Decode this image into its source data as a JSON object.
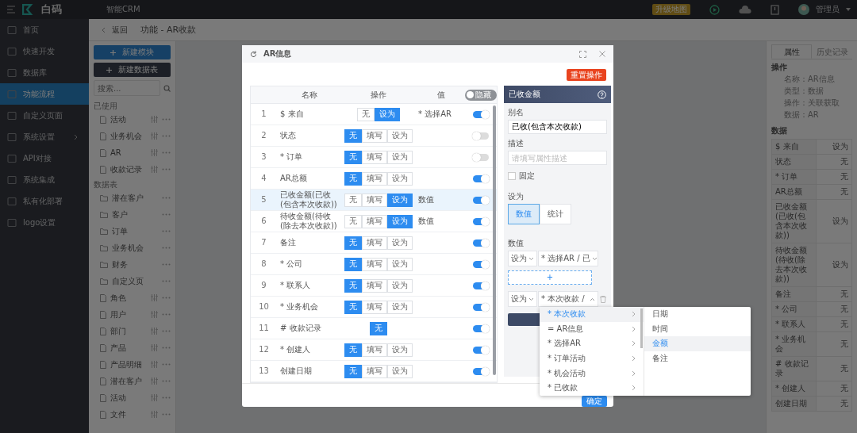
{
  "topbar": {
    "brand": "白码",
    "app": "智能CRM",
    "badge": "升级地图",
    "user": "管理员"
  },
  "nav": [
    {
      "label": "首页",
      "selected": false,
      "expandable": false
    },
    {
      "label": "快速开发",
      "selected": false,
      "expandable": false
    },
    {
      "label": "数据库",
      "selected": false,
      "expandable": false
    },
    {
      "label": "功能流程",
      "selected": true,
      "expandable": false
    },
    {
      "label": "自定义页面",
      "selected": false,
      "expandable": false
    },
    {
      "label": "系统设置",
      "selected": false,
      "expandable": true
    },
    {
      "label": "API对接",
      "selected": false,
      "expandable": false
    },
    {
      "label": "系统集成",
      "selected": false,
      "expandable": false
    },
    {
      "label": "私有化部署",
      "selected": false,
      "expandable": false
    },
    {
      "label": "logo设置",
      "selected": false,
      "expandable": false
    }
  ],
  "breadcrumb": {
    "back": "返回",
    "path": "功能 - AR收款"
  },
  "module_panel": {
    "buttons": [
      "新建模块",
      "新建数据表"
    ],
    "search_placeholder": "搜索...",
    "groups": [
      {
        "title": "已使用",
        "items": [
          {
            "label": "活动",
            "kind": "file"
          },
          {
            "label": "业务机会",
            "kind": "file"
          },
          {
            "label": "AR",
            "kind": "file"
          },
          {
            "label": "收款记录",
            "kind": "file"
          }
        ]
      },
      {
        "title": "数据表",
        "items": [
          {
            "label": "潜在客户",
            "kind": "folder"
          },
          {
            "label": "客户",
            "kind": "folder"
          },
          {
            "label": "订单",
            "kind": "folder"
          },
          {
            "label": "业务机会",
            "kind": "folder"
          },
          {
            "label": "财务",
            "kind": "folder"
          },
          {
            "label": "自定义页",
            "kind": "folder"
          },
          {
            "label": "角色",
            "kind": "file"
          },
          {
            "label": "用户",
            "kind": "file"
          },
          {
            "label": "部门",
            "kind": "file"
          },
          {
            "label": "产品",
            "kind": "file"
          },
          {
            "label": "产品明细",
            "kind": "file"
          },
          {
            "label": "潜在客户",
            "kind": "file"
          },
          {
            "label": "活动",
            "kind": "file"
          },
          {
            "label": "文件",
            "kind": "file"
          }
        ]
      }
    ]
  },
  "properties": {
    "tabs": [
      {
        "label": "属性",
        "selected": true
      },
      {
        "label": "历史记录",
        "selected": false
      }
    ],
    "operation_title": "操作",
    "operation_lines": [
      "名称：AR信息",
      "类型：数据",
      "操作：关联获取",
      "数据：AR"
    ],
    "data_title": "数据",
    "rows": [
      {
        "name": "$ 来自",
        "value": "设为"
      },
      {
        "name": "状态",
        "value": "无"
      },
      {
        "name": "* 订单",
        "value": "无"
      },
      {
        "name": "AR总额",
        "value": "无"
      },
      {
        "name": "已收金额(已收(包含本次收款))",
        "value": "设为"
      },
      {
        "name": "待收金额(待收(除去本次收款))",
        "value": "设为"
      },
      {
        "name": "备注",
        "value": "无"
      },
      {
        "name": "* 公司",
        "value": "无"
      },
      {
        "name": "* 联系人",
        "value": "无"
      },
      {
        "name": "* 业务机会",
        "value": "无"
      },
      {
        "name": "# 收款记录",
        "value": "无"
      },
      {
        "name": "* 创建人",
        "value": "无"
      },
      {
        "name": "创建日期",
        "value": "无"
      }
    ]
  },
  "dialog": {
    "title": "AR信息",
    "reset_button": "重置操作",
    "columns": [
      "名称",
      "操作",
      "值"
    ],
    "hide_toggle": {
      "label": "隐藏",
      "on": false
    },
    "rows": [
      {
        "index": "1",
        "name": "$ 来自",
        "options": [
          {
            "label": "无",
            "selected": false
          },
          {
            "label": "设为",
            "selected": true
          }
        ],
        "value": "* 选择AR",
        "visible": true,
        "selected": false
      },
      {
        "index": "2",
        "name": "状态",
        "options": [
          {
            "label": "无",
            "selected": true
          },
          {
            "label": "填写",
            "selected": false
          },
          {
            "label": "设为",
            "selected": false
          }
        ],
        "visible": false,
        "selected": false
      },
      {
        "index": "3",
        "name": "* 订单",
        "options": [
          {
            "label": "无",
            "selected": true
          },
          {
            "label": "填写",
            "selected": false
          },
          {
            "label": "设为",
            "selected": false
          }
        ],
        "visible": false,
        "selected": false
      },
      {
        "index": "4",
        "name": "AR总额",
        "options": [
          {
            "label": "无",
            "selected": true
          },
          {
            "label": "填写",
            "selected": false
          },
          {
            "label": "设为",
            "selected": false
          }
        ],
        "visible": true,
        "selected": false
      },
      {
        "index": "5",
        "name": "已收金额(已收(包含本次收款))",
        "options": [
          {
            "label": "无",
            "selected": false
          },
          {
            "label": "填写",
            "selected": false
          },
          {
            "label": "设为",
            "selected": true
          }
        ],
        "value": "数值",
        "visible": true,
        "selected": true
      },
      {
        "index": "6",
        "name": "待收金额(待收(除去本次收款))",
        "options": [
          {
            "label": "无",
            "selected": false
          },
          {
            "label": "填写",
            "selected": false
          },
          {
            "label": "设为",
            "selected": true
          }
        ],
        "value": "数值",
        "visible": true,
        "selected": false
      },
      {
        "index": "7",
        "name": "备注",
        "options": [
          {
            "label": "无",
            "selected": true
          },
          {
            "label": "填写",
            "selected": false
          },
          {
            "label": "设为",
            "selected": false
          }
        ],
        "visible": true,
        "selected": false
      },
      {
        "index": "8",
        "name": "* 公司",
        "options": [
          {
            "label": "无",
            "selected": true
          },
          {
            "label": "填写",
            "selected": false
          },
          {
            "label": "设为",
            "selected": false
          }
        ],
        "visible": true,
        "selected": false
      },
      {
        "index": "9",
        "name": "* 联系人",
        "options": [
          {
            "label": "无",
            "selected": true
          },
          {
            "label": "填写",
            "selected": false
          },
          {
            "label": "设为",
            "selected": false
          }
        ],
        "visible": true,
        "selected": false
      },
      {
        "index": "10",
        "name": "* 业务机会",
        "options": [
          {
            "label": "无",
            "selected": true
          },
          {
            "label": "填写",
            "selected": false
          },
          {
            "label": "设为",
            "selected": false
          }
        ],
        "visible": true,
        "selected": false
      },
      {
        "index": "11",
        "name": "# 收款记录",
        "options": [
          {
            "label": "无",
            "selected": true
          }
        ],
        "visible": true,
        "selected": false
      },
      {
        "index": "12",
        "name": "* 创建人",
        "options": [
          {
            "label": "无",
            "selected": true
          },
          {
            "label": "填写",
            "selected": false
          },
          {
            "label": "设为",
            "selected": false
          }
        ],
        "visible": true,
        "selected": false
      },
      {
        "index": "13",
        "name": "创建日期",
        "options": [
          {
            "label": "无",
            "selected": true
          },
          {
            "label": "填写",
            "selected": false
          },
          {
            "label": "设为",
            "selected": false
          }
        ],
        "visible": true,
        "selected": false
      }
    ],
    "editor": {
      "title": "已收金额",
      "alias_label": "别名",
      "alias": "已收(包含本次收款)",
      "desc_label": "描述",
      "desc_placeholder": "请填写属性描述",
      "fixed": {
        "label": "固定",
        "checked": false
      },
      "set_label": "设为",
      "modes": [
        {
          "label": "数值",
          "selected": true
        },
        {
          "label": "统计",
          "selected": false
        }
      ],
      "value_label": "数值",
      "rules": [
        {
          "op": "设为",
          "target": "* 选择AR / 已",
          "expanded": false,
          "deletable": false
        },
        {
          "op": "设为",
          "target": "* 本次收款 /",
          "expanded": true,
          "deletable": true
        }
      ],
      "add_button": "+"
    },
    "confirm_button": "确定"
  },
  "cascader": {
    "columns": [
      [
        {
          "label": "* 本次收款",
          "selected": true
        },
        {
          "label": "= AR信息",
          "selected": false
        },
        {
          "label": "* 选择AR",
          "selected": false
        },
        {
          "label": "* 订单活动",
          "selected": false
        },
        {
          "label": "* 机会活动",
          "selected": false
        },
        {
          "label": "* 已收款",
          "selected": false
        }
      ],
      [
        {
          "label": "日期",
          "selected": false
        },
        {
          "label": "时间",
          "selected": false
        },
        {
          "label": "金额",
          "selected": true
        },
        {
          "label": "备注",
          "selected": false
        }
      ]
    ]
  }
}
